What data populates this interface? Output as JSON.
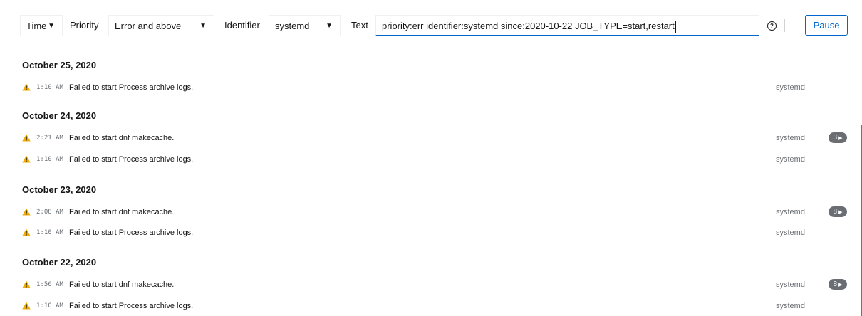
{
  "toolbar": {
    "time_select": "Time",
    "priority_label": "Priority",
    "priority_select": "Error and above",
    "identifier_label": "Identifier",
    "identifier_select": "systemd",
    "text_label": "Text",
    "text_value": "priority:err identifier:systemd since:2020-10-22 JOB_TYPE=start,restart",
    "help_icon": "?",
    "pause_label": "Pause"
  },
  "groups": [
    {
      "date": "October 25, 2020",
      "entries": [
        {
          "time": "1:10 AM",
          "message": "Failed to start Process archive logs.",
          "identifier": "systemd",
          "count": ""
        }
      ]
    },
    {
      "date": "October 24, 2020",
      "entries": [
        {
          "time": "2:21 AM",
          "message": "Failed to start dnf makecache.",
          "identifier": "systemd",
          "count": "3"
        },
        {
          "time": "1:10 AM",
          "message": "Failed to start Process archive logs.",
          "identifier": "systemd",
          "count": ""
        }
      ]
    },
    {
      "date": "October 23, 2020",
      "entries": [
        {
          "time": "2:08 AM",
          "message": "Failed to start dnf makecache.",
          "identifier": "systemd",
          "count": "8"
        },
        {
          "time": "1:10 AM",
          "message": "Failed to start Process archive logs.",
          "identifier": "systemd",
          "count": ""
        }
      ]
    },
    {
      "date": "October 22, 2020",
      "entries": [
        {
          "time": "1:56 AM",
          "message": "Failed to start dnf makecache.",
          "identifier": "systemd",
          "count": "8"
        },
        {
          "time": "1:10 AM",
          "message": "Failed to start Process archive logs.",
          "identifier": "systemd",
          "count": ""
        }
      ]
    }
  ],
  "icons": {
    "warning": "warning-triangle-icon",
    "caret": "caret-down-icon",
    "badge_arrow": "caret-right-icon"
  },
  "colors": {
    "accent": "#0066cc",
    "warning": "#f0ab00",
    "badge": "#6a6e73"
  }
}
